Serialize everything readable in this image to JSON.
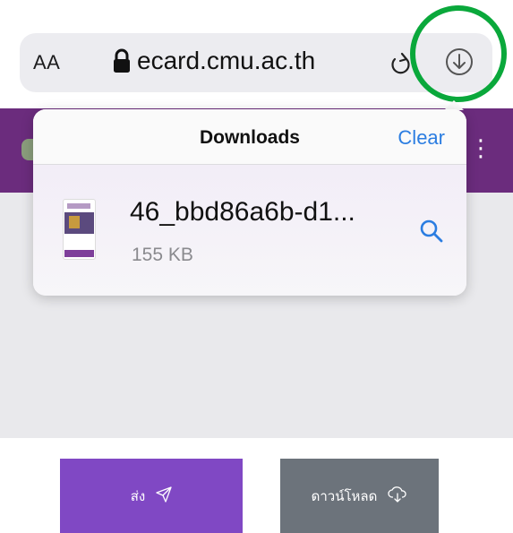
{
  "browser": {
    "text_size_label": "AA",
    "domain": "ecard.cmu.ac.th",
    "icons": {
      "lock": "lock-icon",
      "reload": "reload-icon",
      "downloads": "download-arrow-circle-icon"
    },
    "highlight_color": "#0aa83b"
  },
  "downloads_popover": {
    "title": "Downloads",
    "clear_label": "Clear",
    "items": [
      {
        "file_name": "46_bbd86a6b-d1...",
        "file_size": "155 KB",
        "action_icon": "magnifier-icon"
      }
    ]
  },
  "page": {
    "header_color": "#6b2c7d",
    "send_button": {
      "label": "ส่ง",
      "icon": "paper-plane-icon",
      "color": "#8048c4"
    },
    "download_button": {
      "label": "ดาวน์โหลด",
      "icon": "cloud-download-icon",
      "color": "#6c737b"
    }
  }
}
